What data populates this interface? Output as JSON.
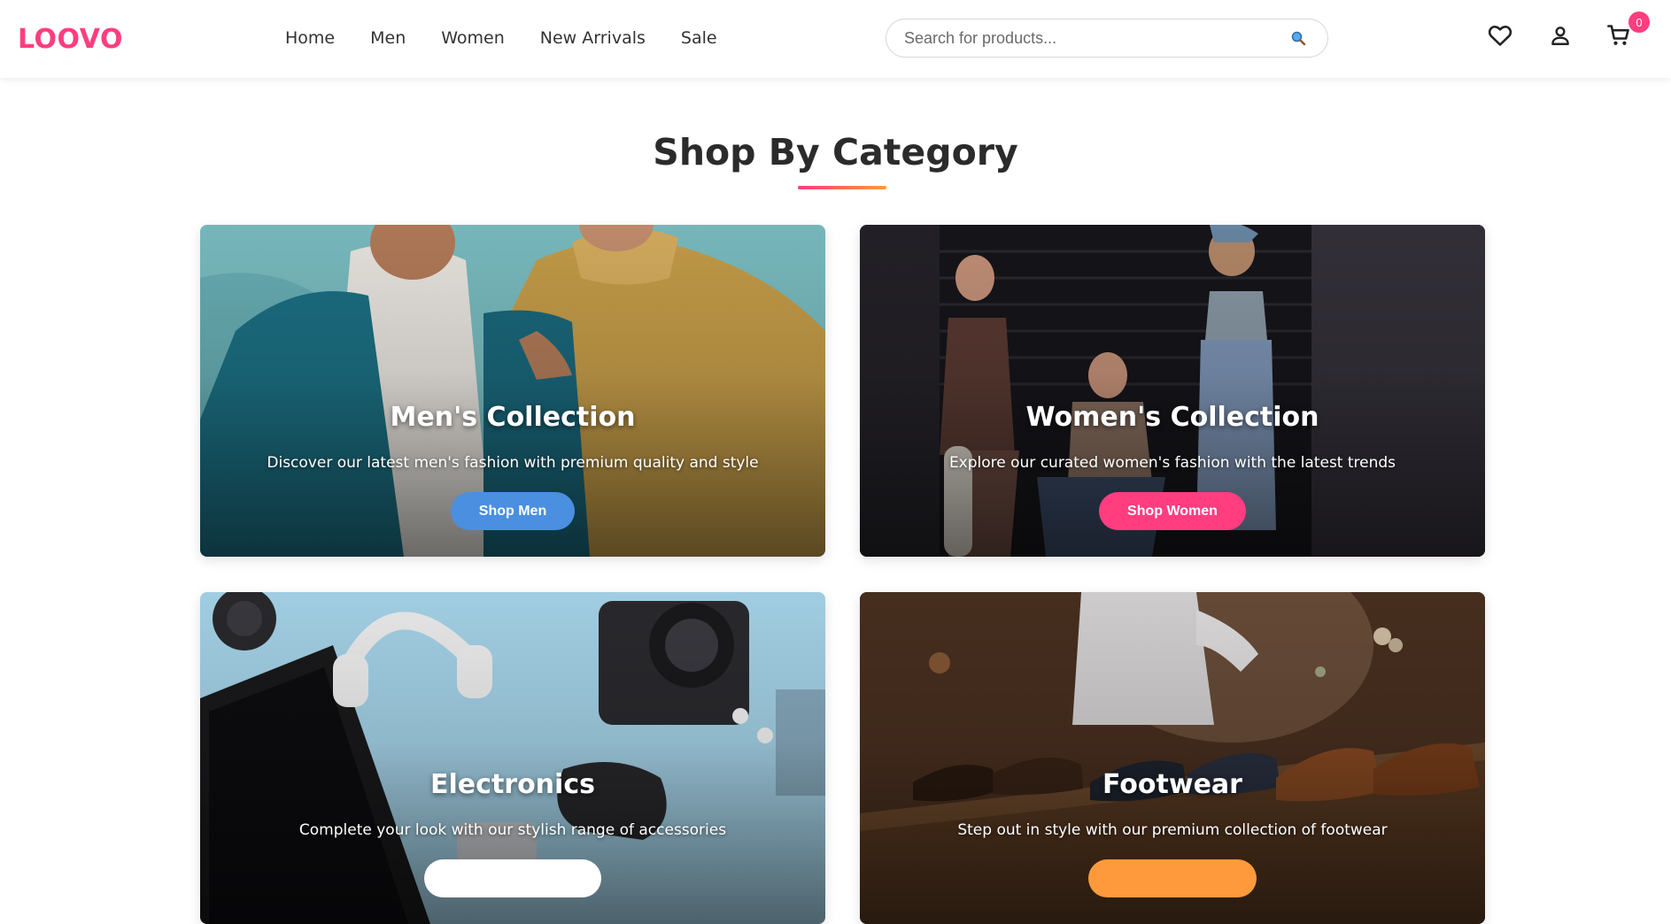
{
  "brand": {
    "name": "LOOVO",
    "accent": "#ff3d7f"
  },
  "nav": {
    "items": [
      {
        "label": "Home"
      },
      {
        "label": "Men"
      },
      {
        "label": "Women"
      },
      {
        "label": "New Arrivals"
      },
      {
        "label": "Sale"
      }
    ]
  },
  "search": {
    "placeholder": "Search for products...",
    "icon": "search-icon"
  },
  "header_icons": {
    "wishlist": "heart-icon",
    "account": "user-icon",
    "cart": "cart-icon",
    "cart_count": "0"
  },
  "section": {
    "title": "Shop By Category"
  },
  "categories": [
    {
      "title": "Men's Collection",
      "description": "Discover our latest men's fashion with premium quality and style",
      "button": "Shop Men",
      "button_color": "#4a8fe0"
    },
    {
      "title": "Women's Collection",
      "description": "Explore our curated women's fashion with the latest trends",
      "button": "Shop Women",
      "button_color": "#ff3d7f"
    },
    {
      "title": "Electronics",
      "description": "Complete your look with our stylish range of accessories",
      "button": "",
      "button_color": "#ffffff"
    },
    {
      "title": "Footwear",
      "description": "Step out in style with our premium collection of footwear",
      "button": "",
      "button_color": "#ff9a3c"
    }
  ]
}
